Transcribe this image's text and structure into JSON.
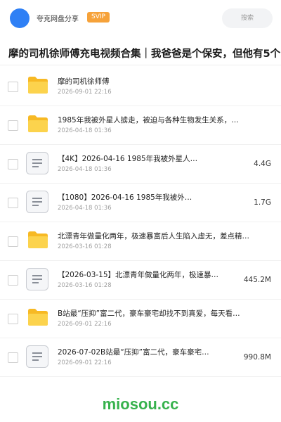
{
  "header": {
    "brand": "夸克网盘分享",
    "badge": "SVIP",
    "search_label": "搜索",
    "accent_color": "#2f80f5",
    "badge_color": "#f6a23a"
  },
  "page_title": "摩的司机徐师傅充电视频合集｜我爸爸是个保安，但他有5个",
  "files": [
    {
      "type": "folder",
      "icon": "folder-icon",
      "name": "摩的司机徐师傅",
      "date": "2026-09-01 22:16",
      "size": ""
    },
    {
      "type": "folder",
      "icon": "folder-icon",
      "name": "1985年我被外星人掳走，被迫与各种生物发生关系，…",
      "date": "2026-04-18 01:36",
      "size": ""
    },
    {
      "type": "file",
      "icon": "document-icon",
      "name": "【4K】2026-04-16 1985年我被外星人…",
      "date": "2026-04-18 01:36",
      "size": "4.4G"
    },
    {
      "type": "file",
      "icon": "document-icon",
      "name": "【1080】2026-04-16 1985年我被外…",
      "date": "2026-04-18 01:36",
      "size": "1.7G"
    },
    {
      "type": "folder",
      "icon": "folder-icon",
      "name": "北漂青年做量化两年，极速暴富后人生陷入虚无，差点精…",
      "date": "2026-03-16 01:28",
      "size": ""
    },
    {
      "type": "file",
      "icon": "document-icon",
      "name": "【2026-03-15】北漂青年做量化两年，极速暴…",
      "date": "2026-03-16 01:28",
      "size": "445.2M"
    },
    {
      "type": "folder",
      "icon": "folder-icon",
      "name": "B站最“压抑”富二代，豪车豪宅却找不到真爱，每天看…",
      "date": "2026-09-01 22:16",
      "size": ""
    },
    {
      "type": "file",
      "icon": "document-icon",
      "name": "2026-07-02B站最“压抑”富二代，豪车豪宅…",
      "date": "2026-09-01 22:16",
      "size": "990.8M"
    }
  ],
  "watermark": "miosou.cc",
  "watermark_color": "#37b24d"
}
